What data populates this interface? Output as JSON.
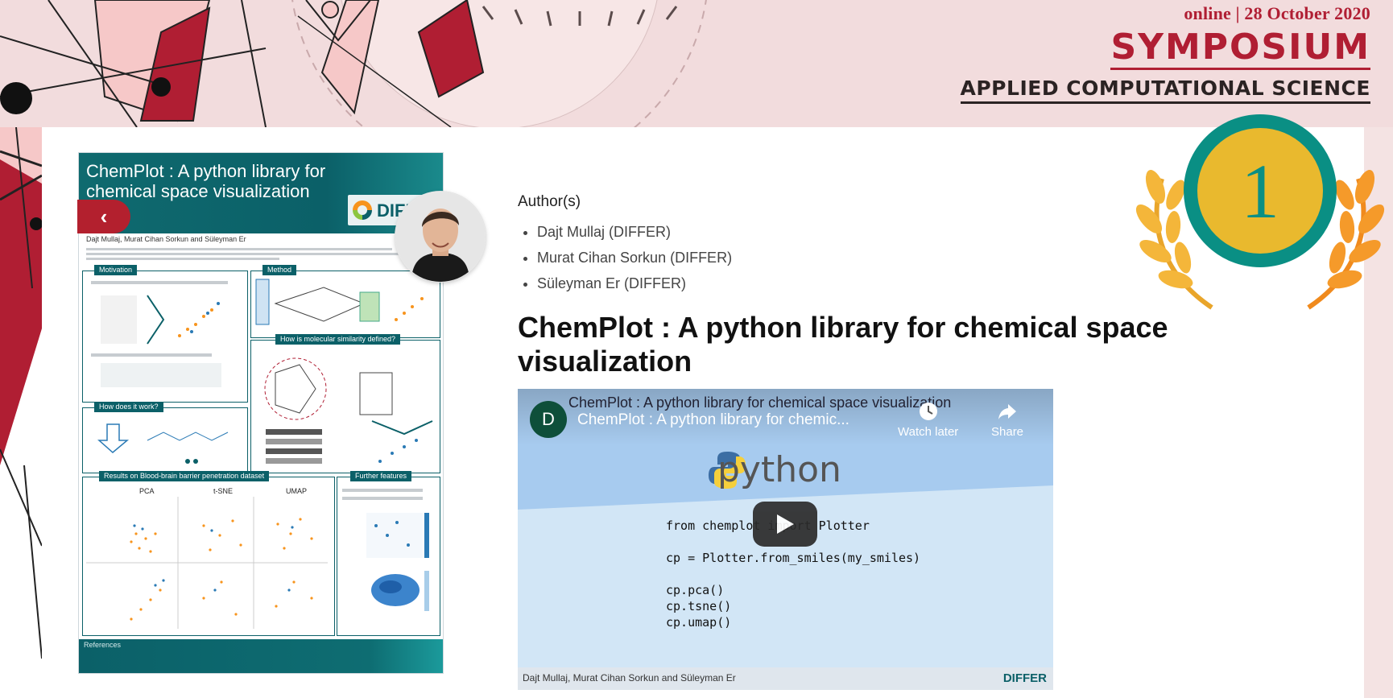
{
  "banner": {
    "date": "online | 28 October 2020",
    "title": "SYMPOSIUM",
    "subtitle": "APPLIED COMPUTATIONAL SCIENCE"
  },
  "poster": {
    "title": "ChemPlot : A python library for chemical space visualization",
    "logo": "DIFFER",
    "authors": "Dajt Mullaj, Murat Cihan Sorkun and Süleyman Er",
    "sections": {
      "motivation": "Motivation",
      "method": "Method",
      "similarity": "How is molecular similarity defined?",
      "how_it_works": "How does it work?",
      "results": "Results on Blood-brain barrier penetration dataset",
      "further": "Further features",
      "references": "References"
    },
    "columns": [
      "PCA",
      "t-SNE",
      "UMAP"
    ]
  },
  "carousel": {
    "prev_icon": "chevron-left-icon"
  },
  "authors_section": {
    "heading": "Author(s)",
    "authors": [
      "Dajt Mullaj (DIFFER)",
      "Murat Cihan Sorkun (DIFFER)",
      "Süleyman Er (DIFFER)"
    ]
  },
  "paper_title": "ChemPlot : A python library for chemical space visualization",
  "video": {
    "channel_initial": "D",
    "title_behind": "ChemPlot : A python library for chemical space visualization",
    "title": "ChemPlot : A python library for chemic...",
    "watch_later": "Watch later",
    "share": "Share",
    "python_text": "python",
    "code": "from chemplot import Plotter\n\ncp = Plotter.from_smiles(my_smiles)\n\ncp.pca()\ncp.tsne()\ncp.umap()",
    "credits": "Dajt Mullaj, Murat Cihan Sorkun and Süleyman Er",
    "logo": "DIFFER"
  },
  "award": {
    "rank": "1"
  },
  "colors": {
    "brand_red": "#b01e33",
    "teal": "#0b6068",
    "gold": "#e9b92e",
    "award_green": "#0a8f84"
  }
}
